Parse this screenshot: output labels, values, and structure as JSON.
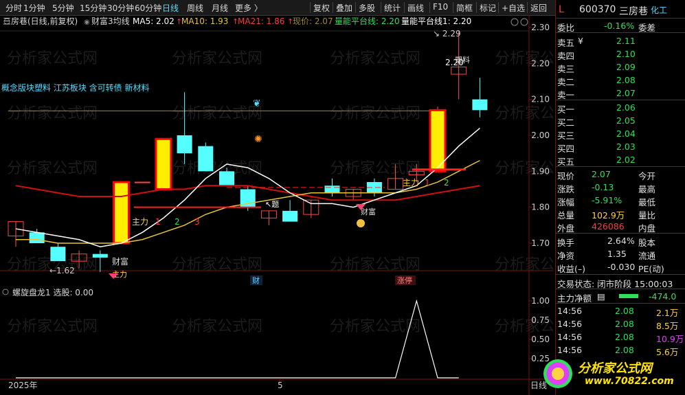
{
  "toolbar": {
    "left_items": [
      "分时",
      "1分钟",
      "5分钟",
      "15分钟",
      "30分钟",
      "60分钟",
      "日线",
      "周线",
      "月线",
      "更多 〉"
    ],
    "active": "日线",
    "right_items": [
      "复权",
      "叠加",
      "多股",
      "统计",
      "画线",
      "F10",
      "简框",
      "标记",
      "+自选",
      "返回"
    ]
  },
  "chart_header": {
    "title": "三房巷(日线,前复权)",
    "indicator": "财富3均线",
    "ma5": "MA5: 2.02",
    "ma10": "MA10: 1.93",
    "ma21": "MA21: 1.86",
    "price_now": "现价: 2.07",
    "platform": "量能平台线: 2.20",
    "platform1": "量能平台线1: 2.20"
  },
  "concept_tags": "概念版块塑料 江苏板块 含可转债 新材料",
  "watermark": "分析家公式网 www.70822.com",
  "main_axis": {
    "labels": [
      "2.30",
      "2.20",
      "2.10",
      "2.00",
      "1.90",
      "1.80",
      "1.70"
    ],
    "values": [
      2.3,
      2.2,
      2.1,
      2.0,
      1.9,
      1.8,
      1.7
    ]
  },
  "sub_panel": {
    "title": "螺旋盘龙1 选股: 0.00",
    "axis_labels": [
      "1.00",
      "0.75",
      "0.50",
      "0.25"
    ],
    "axis_values": [
      1.0,
      0.75,
      0.5,
      0.25
    ],
    "signal_values": [
      0,
      0,
      0,
      0,
      0,
      0,
      0,
      0,
      0,
      0,
      0,
      0,
      0,
      0,
      0,
      0,
      0,
      0,
      0,
      1,
      0,
      0
    ]
  },
  "x_axis": {
    "year": "2025年",
    "month": "5",
    "right": "日线"
  },
  "annotations": {
    "low": "←1.62",
    "high": "2.29",
    "high2": "2.20",
    "main_force": "主力",
    "wealth": "财富",
    "cai": "财",
    "zhangting": "涨停",
    "num1": "1",
    "num2": "2",
    "num3": "3",
    "plastic": "塑料"
  },
  "chart_data": {
    "type": "candlestick",
    "ylim": [
      1.63,
      2.33
    ],
    "candles": [
      {
        "o": 1.72,
        "h": 1.76,
        "l": 1.69,
        "c": 1.76
      },
      {
        "o": 1.73,
        "h": 1.74,
        "l": 1.7,
        "c": 1.7
      },
      {
        "o": 1.69,
        "h": 1.7,
        "l": 1.65,
        "c": 1.65
      },
      {
        "o": 1.65,
        "h": 1.68,
        "l": 1.63,
        "c": 1.67
      },
      {
        "o": 1.67,
        "h": 1.68,
        "l": 1.62,
        "c": 1.66
      },
      {
        "o": 1.7,
        "h": 1.87,
        "l": 1.7,
        "c": 1.87
      },
      {
        "o": 1.87,
        "h": 1.87,
        "l": 1.87,
        "c": 1.87
      },
      {
        "o": 1.85,
        "h": 1.99,
        "l": 1.85,
        "c": 1.99
      },
      {
        "o": 2.0,
        "h": 2.12,
        "l": 1.92,
        "c": 1.95
      },
      {
        "o": 1.97,
        "h": 1.98,
        "l": 1.9,
        "c": 1.9
      },
      {
        "o": 1.9,
        "h": 1.91,
        "l": 1.86,
        "c": 1.86
      },
      {
        "o": 1.85,
        "h": 1.86,
        "l": 1.79,
        "c": 1.8
      },
      {
        "o": 1.77,
        "h": 1.79,
        "l": 1.75,
        "c": 1.79
      },
      {
        "o": 1.79,
        "h": 1.82,
        "l": 1.76,
        "c": 1.76
      },
      {
        "o": 1.78,
        "h": 1.82,
        "l": 1.77,
        "c": 1.82
      },
      {
        "o": 1.86,
        "h": 1.88,
        "l": 1.83,
        "c": 1.84
      },
      {
        "o": 1.83,
        "h": 1.85,
        "l": 1.82,
        "c": 1.85
      },
      {
        "o": 1.87,
        "h": 1.88,
        "l": 1.83,
        "c": 1.84
      },
      {
        "o": 1.85,
        "h": 1.92,
        "l": 1.85,
        "c": 1.88
      },
      {
        "o": 1.89,
        "h": 1.92,
        "l": 1.87,
        "c": 1.9
      },
      {
        "o": 1.9,
        "h": 2.08,
        "l": 1.9,
        "c": 2.07
      },
      {
        "o": 2.17,
        "h": 2.29,
        "l": 2.1,
        "c": 2.19
      },
      {
        "o": 2.1,
        "h": 2.16,
        "l": 2.05,
        "c": 2.07
      }
    ],
    "ma5": [
      1.74,
      1.73,
      1.72,
      1.71,
      1.69,
      1.7,
      1.73,
      1.77,
      1.82,
      1.88,
      1.92,
      1.91,
      1.88,
      1.84,
      1.81,
      1.81,
      1.8,
      1.82,
      1.84,
      1.86,
      1.91,
      1.97,
      2.02
    ],
    "ma10": [
      1.71,
      1.71,
      1.7,
      1.7,
      1.7,
      1.7,
      1.71,
      1.73,
      1.75,
      1.78,
      1.8,
      1.81,
      1.82,
      1.83,
      1.84,
      1.84,
      1.84,
      1.84,
      1.84,
      1.85,
      1.87,
      1.9,
      1.93
    ],
    "ma21": [
      1.86,
      1.85,
      1.84,
      1.83,
      1.83,
      1.83,
      1.84,
      1.85,
      1.85,
      1.86,
      1.86,
      1.86,
      1.85,
      1.84,
      1.83,
      1.82,
      1.82,
      1.82,
      1.82,
      1.83,
      1.84,
      1.85,
      1.86
    ]
  },
  "quote": {
    "code": "600370",
    "name": "三房巷",
    "tag": "L",
    "sector": "化工",
    "weibi_label": "委比",
    "weibi": "-0.16%",
    "weicha_label": "委差",
    "asks": [
      {
        "label": "卖五",
        "price": "2.11",
        "mark": "¥"
      },
      {
        "label": "卖四",
        "price": "2.10"
      },
      {
        "label": "卖三",
        "price": "2.09"
      },
      {
        "label": "卖二",
        "price": "2.08"
      },
      {
        "label": "卖一",
        "price": "2.07"
      }
    ],
    "bids": [
      {
        "label": "买一",
        "price": "2.06"
      },
      {
        "label": "买二",
        "price": "2.05"
      },
      {
        "label": "买三",
        "price": "2.04"
      },
      {
        "label": "买四",
        "price": "2.03"
      },
      {
        "label": "买五",
        "price": "2.02"
      }
    ],
    "stats": [
      {
        "l1": "现价",
        "v1": "2.07",
        "c1": "g",
        "l2": "今开",
        "v2": "",
        "c2": "w"
      },
      {
        "l1": "涨跌",
        "v1": "-0.13",
        "c1": "g",
        "l2": "最高",
        "v2": "",
        "c2": "w"
      },
      {
        "l1": "涨幅",
        "v1": "-5.91%",
        "c1": "g",
        "l2": "最低",
        "v2": "",
        "c2": "w"
      },
      {
        "l1": "总量",
        "v1": "102.9万",
        "c1": "y",
        "l2": "量比",
        "v2": "",
        "c2": "w"
      },
      {
        "l1": "外盘",
        "v1": "426086",
        "c1": "r",
        "l2": "内盘",
        "v2": "",
        "c2": "w"
      }
    ],
    "stats2": [
      {
        "l1": "换手",
        "v1": "2.64%",
        "l2": "股本"
      },
      {
        "l1": "净资",
        "v1": "1.35",
        "l2": "流通"
      },
      {
        "l1": "收益(–)",
        "v1": "-0.030",
        "l2": "PE(动)"
      }
    ],
    "trade_status": "交易状态: 闭市阶段 15:00:03",
    "main_net_label": "主力净额",
    "main_net": "-474.0",
    "ticks": [
      {
        "time": "14:56",
        "price": "2.08",
        "vol": "2.1万",
        "c": "y"
      },
      {
        "time": "14:56",
        "price": "2.08",
        "vol": "8.5万",
        "c": "y"
      },
      {
        "time": "14:56",
        "price": "2.08",
        "vol": "10.9万",
        "c": "m"
      },
      {
        "time": "14:56",
        "price": "2.08",
        "vol": "5.6万",
        "c": "y"
      }
    ],
    "logo_text": "分析家公式网",
    "logo_url": "www.70822.com"
  },
  "colors": {
    "up": "#ff2b2b",
    "down": "#55ffff",
    "ma5": "#ffffff",
    "ma10": "#e8c23a",
    "ma21": "#d01010",
    "bg": "#000000"
  }
}
